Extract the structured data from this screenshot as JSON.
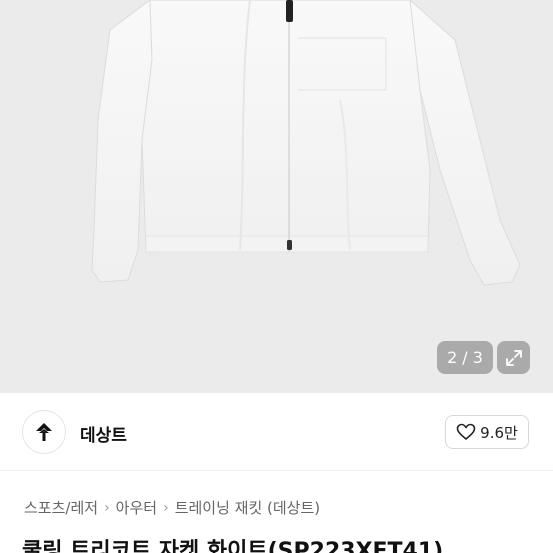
{
  "hero": {
    "pager_current": "2",
    "pager_sep": "/",
    "pager_total": "3"
  },
  "brand": {
    "name": "데상트",
    "likes": "9.6만",
    "logo_icon": "descente-arrow-icon"
  },
  "breadcrumb": [
    "스포츠/레저",
    "아우터",
    "트레이닝 재킷 (데상트)"
  ],
  "product": {
    "title": "쿨링 트리코트 자켓 화이트(SP223XFT41)"
  },
  "colors": {
    "hero_bg": "#ebebeb",
    "jacket": "#f6f6f6",
    "overlay": "#5a5a5a"
  }
}
